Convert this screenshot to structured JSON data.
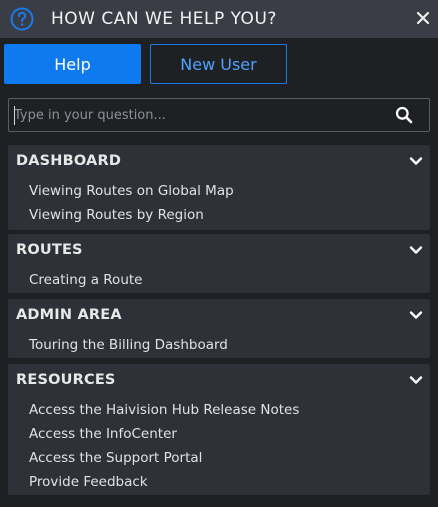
{
  "header": {
    "title": "HOW CAN WE HELP YOU?",
    "help_icon": "question-circle-icon",
    "close_icon": "close-icon"
  },
  "tabs": [
    {
      "label": "Help",
      "active": true
    },
    {
      "label": "New User",
      "active": false
    }
  ],
  "search": {
    "placeholder": "Type in your question...",
    "value": "",
    "icon": "search-icon"
  },
  "sections": [
    {
      "title": "DASHBOARD",
      "items": [
        "Viewing Routes on Global Map",
        "Viewing Routes by Region"
      ]
    },
    {
      "title": "ROUTES",
      "items": [
        "Creating a Route"
      ]
    },
    {
      "title": "ADMIN AREA",
      "items": [
        "Touring the Billing Dashboard"
      ]
    },
    {
      "title": "RESOURCES",
      "items": [
        "Access the Haivision Hub Release Notes",
        "Access the InfoCenter",
        "Access the Support Portal",
        "Provide Feedback"
      ]
    }
  ],
  "colors": {
    "accent": "#0f7af0",
    "background": "#1f2024",
    "header": "#3a3d45",
    "section": "#2f3138"
  }
}
